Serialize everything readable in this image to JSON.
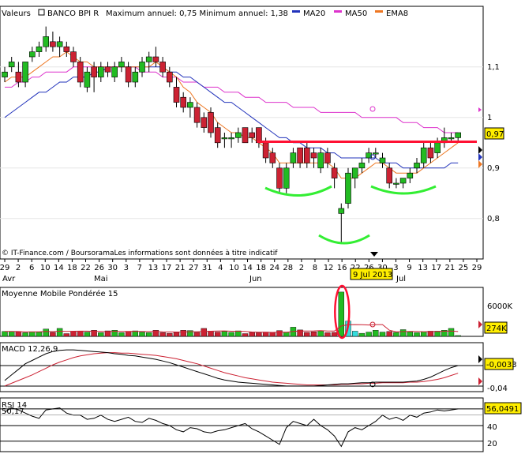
{
  "legend": {
    "valeurs": "Valeurs",
    "name": "BANCO BPI R",
    "minmax": "Maximum annuel: 0,75 Minimum annuel: 1,38",
    "ma20": "MA20",
    "ma50": "MA50",
    "ema8": "EMA8"
  },
  "colors": {
    "up": "#22bb22",
    "down": "#cc2233",
    "ma20": "#2233bb",
    "ma50": "#dd33cc",
    "ema8": "#ee7722",
    "annotation_red": "#ff1133",
    "annotation_green": "#33ee33",
    "value_box": "#ffee00"
  },
  "copyright": "© IT-Finance.com / BoursoramaLes informations sont données à titre indicatif",
  "cursor_date": "9 Jul 2013",
  "x_dates": [
    "29",
    "2",
    "6",
    "10",
    "14",
    "18",
    "22",
    "26",
    "30",
    "3",
    "7",
    "13",
    "17",
    "21",
    "27",
    "31",
    "4",
    "10",
    "14",
    "18",
    "24",
    "28",
    "2",
    "8",
    "12",
    "16",
    "22",
    "26",
    "30",
    "3",
    "9",
    "13",
    "17",
    "21",
    "25",
    "29"
  ],
  "months": [
    "Avr",
    "Mai",
    "Jun",
    "Jul"
  ],
  "price": {
    "y_ticks": [
      "1,1",
      "1",
      "0,9",
      "0,8"
    ],
    "last_value": "0,97"
  },
  "volume": {
    "title": "Moyenne Mobile Pondérée 15",
    "y_tick": "6000K",
    "last_value": "274K"
  },
  "macd": {
    "title": "MACD 12,26,9",
    "last_value": "-0,0033",
    "y_tick": "-0,04"
  },
  "rsi": {
    "title": "RSI 14",
    "sub": "50,17",
    "last_value": "56,0491",
    "y_ticks": [
      "40",
      "20"
    ]
  },
  "chart_data": [
    {
      "type": "candlestick",
      "title": "BANCO BPI R",
      "ylim": [
        0.72,
        1.22
      ],
      "ohlc": [
        [
          1.08,
          1.1,
          1.07,
          1.09
        ],
        [
          1.1,
          1.12,
          1.09,
          1.11
        ],
        [
          1.09,
          1.11,
          1.06,
          1.07
        ],
        [
          1.07,
          1.11,
          1.06,
          1.11
        ],
        [
          1.12,
          1.14,
          1.11,
          1.13
        ],
        [
          1.13,
          1.15,
          1.12,
          1.14
        ],
        [
          1.14,
          1.18,
          1.13,
          1.16
        ],
        [
          1.15,
          1.17,
          1.13,
          1.14
        ],
        [
          1.14,
          1.16,
          1.12,
          1.15
        ],
        [
          1.14,
          1.15,
          1.12,
          1.13
        ],
        [
          1.13,
          1.14,
          1.1,
          1.11
        ],
        [
          1.11,
          1.12,
          1.06,
          1.07
        ],
        [
          1.06,
          1.1,
          1.05,
          1.09
        ],
        [
          1.1,
          1.11,
          1.05,
          1.08
        ],
        [
          1.08,
          1.11,
          1.07,
          1.1
        ],
        [
          1.1,
          1.11,
          1.08,
          1.09
        ],
        [
          1.08,
          1.11,
          1.07,
          1.1
        ],
        [
          1.1,
          1.12,
          1.09,
          1.11
        ],
        [
          1.1,
          1.11,
          1.06,
          1.07
        ],
        [
          1.07,
          1.1,
          1.06,
          1.09
        ],
        [
          1.09,
          1.12,
          1.08,
          1.11
        ],
        [
          1.11,
          1.13,
          1.09,
          1.12
        ],
        [
          1.12,
          1.14,
          1.1,
          1.11
        ],
        [
          1.11,
          1.12,
          1.08,
          1.09
        ],
        [
          1.09,
          1.1,
          1.06,
          1.07
        ],
        [
          1.06,
          1.08,
          1.02,
          1.03
        ],
        [
          1.04,
          1.05,
          1.01,
          1.02
        ],
        [
          1.02,
          1.04,
          1.0,
          1.03
        ],
        [
          1.02,
          1.03,
          0.98,
          0.99
        ],
        [
          1.0,
          1.01,
          0.97,
          0.98
        ],
        [
          1.01,
          1.02,
          0.96,
          0.97
        ],
        [
          0.98,
          0.99,
          0.94,
          0.95
        ],
        [
          0.96,
          0.97,
          0.94,
          0.96
        ],
        [
          0.96,
          0.97,
          0.94,
          0.96
        ],
        [
          0.96,
          0.98,
          0.95,
          0.97
        ],
        [
          0.98,
          0.98,
          0.95,
          0.95
        ],
        [
          0.97,
          0.98,
          0.95,
          0.96
        ],
        [
          0.98,
          0.98,
          0.94,
          0.95
        ],
        [
          0.95,
          0.96,
          0.91,
          0.92
        ],
        [
          0.93,
          0.94,
          0.9,
          0.91
        ],
        [
          0.9,
          0.91,
          0.85,
          0.86
        ],
        [
          0.86,
          0.91,
          0.85,
          0.9
        ],
        [
          0.91,
          0.94,
          0.9,
          0.93
        ],
        [
          0.94,
          0.94,
          0.9,
          0.91
        ],
        [
          0.94,
          0.95,
          0.9,
          0.91
        ],
        [
          0.93,
          0.94,
          0.9,
          0.92
        ],
        [
          0.9,
          0.94,
          0.89,
          0.93
        ],
        [
          0.93,
          0.94,
          0.9,
          0.91
        ],
        [
          0.9,
          0.91,
          0.86,
          0.88
        ],
        [
          0.81,
          0.83,
          0.75,
          0.82
        ],
        [
          0.83,
          0.9,
          0.82,
          0.89
        ],
        [
          0.88,
          0.9,
          0.86,
          0.9
        ],
        [
          0.9,
          0.92,
          0.89,
          0.91
        ],
        [
          0.92,
          0.94,
          0.91,
          0.93
        ],
        [
          0.93,
          0.94,
          0.92,
          0.93
        ],
        [
          0.91,
          0.93,
          0.9,
          0.92
        ],
        [
          0.9,
          0.91,
          0.86,
          0.87
        ],
        [
          0.87,
          0.88,
          0.86,
          0.87
        ],
        [
          0.87,
          0.88,
          0.86,
          0.88
        ],
        [
          0.88,
          0.9,
          0.87,
          0.89
        ],
        [
          0.9,
          0.92,
          0.89,
          0.91
        ],
        [
          0.91,
          0.95,
          0.9,
          0.94
        ],
        [
          0.94,
          0.95,
          0.91,
          0.92
        ],
        [
          0.93,
          0.96,
          0.92,
          0.95
        ],
        [
          0.95,
          0.98,
          0.94,
          0.96
        ],
        [
          0.96,
          0.97,
          0.95,
          0.96
        ],
        [
          0.96,
          0.97,
          0.95,
          0.97
        ]
      ],
      "ma20": [
        1.0,
        1.01,
        1.02,
        1.03,
        1.04,
        1.05,
        1.05,
        1.06,
        1.07,
        1.07,
        1.08,
        1.08,
        1.08,
        1.09,
        1.09,
        1.1,
        1.1,
        1.1,
        1.1,
        1.1,
        1.1,
        1.1,
        1.1,
        1.1,
        1.09,
        1.09,
        1.08,
        1.08,
        1.07,
        1.06,
        1.05,
        1.04,
        1.03,
        1.03,
        1.02,
        1.01,
        1.0,
        0.99,
        0.98,
        0.97,
        0.96,
        0.96,
        0.95,
        0.95,
        0.94,
        0.94,
        0.94,
        0.93,
        0.93,
        0.92,
        0.92,
        0.92,
        0.92,
        0.92,
        0.92,
        0.91,
        0.91,
        0.91,
        0.9,
        0.9,
        0.9,
        0.9,
        0.9,
        0.9,
        0.9,
        0.91,
        0.91
      ],
      "ma50": [
        1.06,
        1.06,
        1.07,
        1.07,
        1.08,
        1.08,
        1.09,
        1.09,
        1.09,
        1.09,
        1.1,
        1.1,
        1.1,
        1.1,
        1.1,
        1.1,
        1.1,
        1.1,
        1.1,
        1.1,
        1.09,
        1.09,
        1.09,
        1.08,
        1.08,
        1.08,
        1.07,
        1.07,
        1.07,
        1.06,
        1.06,
        1.06,
        1.05,
        1.05,
        1.05,
        1.04,
        1.04,
        1.04,
        1.03,
        1.03,
        1.03,
        1.03,
        1.02,
        1.02,
        1.02,
        1.02,
        1.01,
        1.01,
        1.01,
        1.01,
        1.01,
        1.01,
        1.0,
        1.0,
        1.0,
        1.0,
        1.0,
        1.0,
        0.99,
        0.99,
        0.99,
        0.98,
        0.98,
        0.98,
        0.97,
        0.97,
        0.97
      ],
      "ema8": [
        1.07,
        1.08,
        1.08,
        1.08,
        1.09,
        1.1,
        1.11,
        1.12,
        1.12,
        1.13,
        1.12,
        1.11,
        1.11,
        1.1,
        1.1,
        1.1,
        1.1,
        1.1,
        1.1,
        1.1,
        1.1,
        1.1,
        1.11,
        1.1,
        1.09,
        1.08,
        1.06,
        1.05,
        1.03,
        1.02,
        1.01,
        0.99,
        0.98,
        0.97,
        0.97,
        0.96,
        0.96,
        0.95,
        0.94,
        0.93,
        0.91,
        0.91,
        0.91,
        0.91,
        0.91,
        0.91,
        0.91,
        0.91,
        0.9,
        0.88,
        0.88,
        0.88,
        0.89,
        0.9,
        0.91,
        0.91,
        0.9,
        0.89,
        0.89,
        0.89,
        0.89,
        0.9,
        0.91,
        0.92,
        0.93,
        0.94,
        0.95
      ]
    },
    {
      "type": "bar",
      "title": "Moyenne Mobile Pondérée 15",
      "unit": "K",
      "values": [
        1600,
        1600,
        1500,
        1200,
        1500,
        1400,
        2400,
        1300,
        2600,
        900,
        1600,
        1700,
        1400,
        2000,
        1200,
        1800,
        2000,
        1200,
        1600,
        1800,
        1400,
        1200,
        2000,
        1200,
        1000,
        1300,
        2000,
        1900,
        1300,
        2600,
        1700,
        1400,
        1600,
        1300,
        1800,
        900,
        1300,
        1200,
        1400,
        1200,
        1900,
        1400,
        3000,
        2100,
        1300,
        1500,
        1800,
        1200,
        1300,
        14500,
        5000,
        1700,
        1000,
        1400,
        2000,
        1400,
        1600,
        1300,
        2200,
        1500,
        1200,
        1500,
        1700,
        1700,
        2000,
        2600,
        274
      ]
    },
    {
      "type": "line",
      "title": "MACD 12,26,9",
      "series": [
        {
          "values": [
            -0.03,
            -0.02,
            -0.01,
            0.0,
            0.006,
            0.012,
            0.018,
            0.022,
            0.024,
            0.025,
            0.025,
            0.024,
            0.023,
            0.022,
            0.021,
            0.02,
            0.018,
            0.017,
            0.015,
            0.014,
            0.012,
            0.01,
            0.008,
            0.005,
            0.002,
            -0.002,
            -0.006,
            -0.01,
            -0.014,
            -0.018,
            -0.022,
            -0.026,
            -0.029,
            -0.031,
            -0.033,
            -0.034,
            -0.035,
            -0.036,
            -0.037,
            -0.038,
            -0.039,
            -0.04,
            -0.04,
            -0.04,
            -0.04,
            -0.04,
            -0.039,
            -0.038,
            -0.037,
            -0.036,
            -0.036,
            -0.035,
            -0.034,
            -0.034,
            -0.033,
            -0.033,
            -0.033,
            -0.033,
            -0.033,
            -0.032,
            -0.031,
            -0.028,
            -0.024,
            -0.018,
            -0.012,
            -0.007,
            -0.0033
          ]
        },
        {
          "values": [
            -0.04,
            -0.035,
            -0.03,
            -0.025,
            -0.02,
            -0.014,
            -0.008,
            -0.002,
            0.003,
            0.007,
            0.011,
            0.014,
            0.016,
            0.018,
            0.019,
            0.02,
            0.02,
            0.019,
            0.019,
            0.018,
            0.017,
            0.016,
            0.015,
            0.013,
            0.011,
            0.009,
            0.006,
            0.003,
            0.0,
            -0.004,
            -0.008,
            -0.012,
            -0.016,
            -0.019,
            -0.022,
            -0.025,
            -0.027,
            -0.029,
            -0.031,
            -0.033,
            -0.034,
            -0.035,
            -0.036,
            -0.037,
            -0.038,
            -0.038,
            -0.038,
            -0.038,
            -0.038,
            -0.037,
            -0.037,
            -0.036,
            -0.036,
            -0.035,
            -0.035,
            -0.034,
            -0.034,
            -0.034,
            -0.034,
            -0.033,
            -0.033,
            -0.032,
            -0.03,
            -0.028,
            -0.025,
            -0.021,
            -0.017
          ]
        }
      ]
    },
    {
      "type": "line",
      "title": "RSI 14",
      "series": [
        {
          "values": [
            53,
            57,
            55,
            52,
            49,
            47,
            55,
            56,
            57,
            52,
            50,
            50,
            46,
            47,
            50,
            46,
            44,
            46,
            48,
            44,
            43,
            47,
            45,
            42,
            40,
            36,
            34,
            38,
            37,
            34,
            33,
            35,
            36,
            38,
            40,
            42,
            37,
            34,
            30,
            26,
            22,
            38,
            44,
            42,
            40,
            46,
            40,
            36,
            30,
            20,
            34,
            38,
            36,
            40,
            44,
            50,
            46,
            48,
            45,
            50,
            48,
            52,
            53,
            55,
            54,
            55,
            56
          ]
        }
      ]
    }
  ]
}
